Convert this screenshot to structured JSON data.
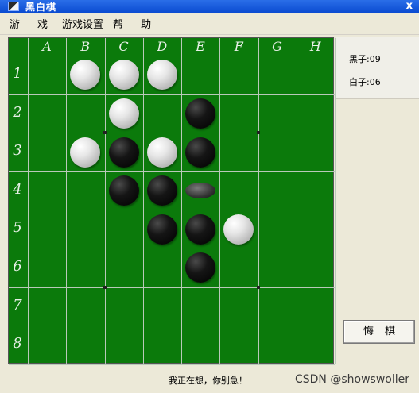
{
  "window": {
    "title": "黑白棋",
    "close": "x"
  },
  "menu": [
    "游",
    "戏",
    "游戏设置",
    "帮",
    "助"
  ],
  "board": {
    "columns": [
      "A",
      "B",
      "C",
      "D",
      "E",
      "F",
      "G",
      "H"
    ],
    "rows": [
      "1",
      "2",
      "3",
      "4",
      "5",
      "6",
      "7",
      "8"
    ],
    "pieces": [
      {
        "cell": "B1",
        "color": "white"
      },
      {
        "cell": "C1",
        "color": "white"
      },
      {
        "cell": "D1",
        "color": "white"
      },
      {
        "cell": "C2",
        "color": "white"
      },
      {
        "cell": "E2",
        "color": "black"
      },
      {
        "cell": "B3",
        "color": "white"
      },
      {
        "cell": "C3",
        "color": "black"
      },
      {
        "cell": "D3",
        "color": "white"
      },
      {
        "cell": "E3",
        "color": "black"
      },
      {
        "cell": "C4",
        "color": "black"
      },
      {
        "cell": "D4",
        "color": "black"
      },
      {
        "cell": "E4",
        "color": "flipping"
      },
      {
        "cell": "D5",
        "color": "black"
      },
      {
        "cell": "E5",
        "color": "black"
      },
      {
        "cell": "F5",
        "color": "white"
      },
      {
        "cell": "E6",
        "color": "black"
      }
    ]
  },
  "scores": {
    "black": "黑子:09",
    "white": "白子:06"
  },
  "regret_button": "悔棋",
  "status": "我正在想，你别急！",
  "watermark": "CSDN @showswoller"
}
